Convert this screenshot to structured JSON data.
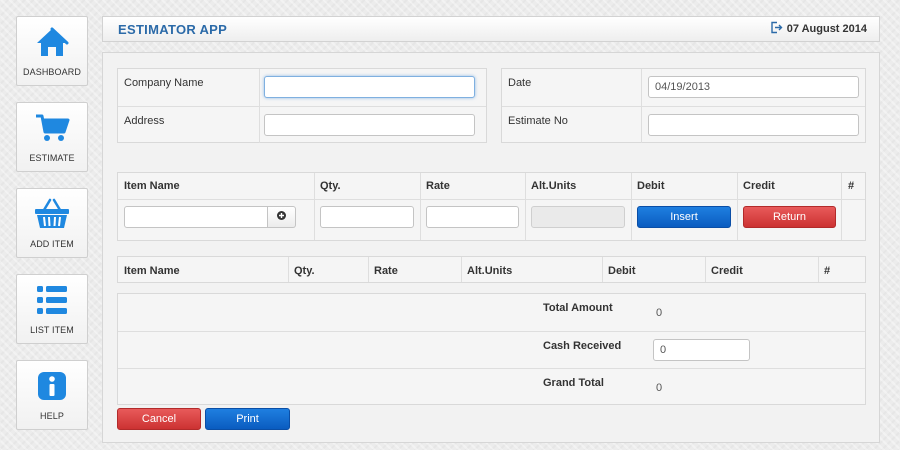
{
  "sidebar": {
    "items": [
      {
        "label": "DASHBOARD",
        "icon": "home-icon"
      },
      {
        "label": "ESTIMATE",
        "icon": "cart-icon"
      },
      {
        "label": "ADD ITEM",
        "icon": "basket-icon"
      },
      {
        "label": "LIST ITEM",
        "icon": "list-icon"
      },
      {
        "label": "HELP",
        "icon": "info-icon"
      }
    ]
  },
  "header": {
    "title": "ESTIMATOR APP",
    "date": "07 August 2014",
    "date_icon": "logout-icon"
  },
  "company_form": {
    "company_name_label": "Company Name",
    "company_name_value": "",
    "address_label": "Address",
    "address_value": ""
  },
  "estimate_form": {
    "date_label": "Date",
    "date_value": "04/19/2013",
    "estimate_no_label": "Estimate No",
    "estimate_no_value": ""
  },
  "item_entry": {
    "headers": [
      "Item Name",
      "Qty.",
      "Rate",
      "Alt.Units",
      "Debit",
      "Credit",
      "#"
    ],
    "insert_label": "Insert",
    "return_label": "Return",
    "add_icon": "plus-circle-icon"
  },
  "items_table": {
    "headers": [
      "Item Name",
      "Qty.",
      "Rate",
      "Alt.Units",
      "Debit",
      "Credit",
      "#"
    ]
  },
  "summary": {
    "total_amount_label": "Total Amount",
    "total_amount_value": "0",
    "cash_received_label": "Cash Received",
    "cash_received_value": "0",
    "grand_total_label": "Grand Total",
    "grand_total_value": "0"
  },
  "actions": {
    "cancel_label": "Cancel",
    "print_label": "Print"
  },
  "colors": {
    "icon_blue": "#1f88e0",
    "title_blue": "#2b6aa8",
    "button_blue": "#0a5cc0",
    "button_red": "#cc3232"
  }
}
